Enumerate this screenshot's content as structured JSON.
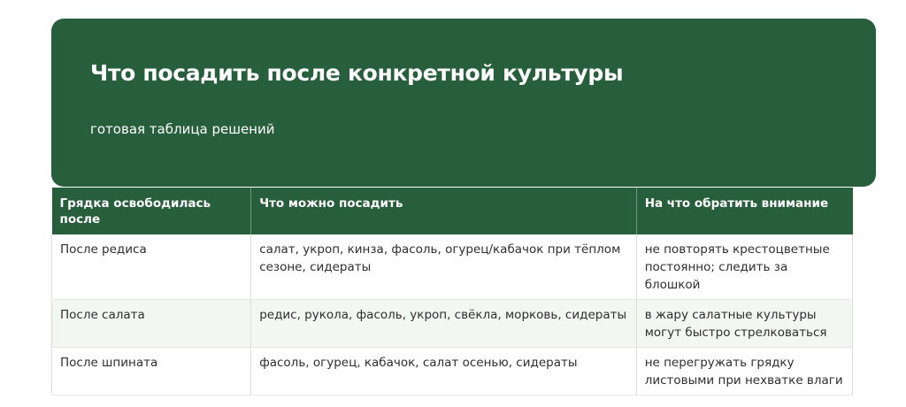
{
  "header": {
    "title": "Что посадить после конкретной культуры",
    "subtitle": "готовая таблица решений"
  },
  "table": {
    "columns": [
      "Грядка освободилась после",
      "Что можно посадить",
      "На что обратить внимание"
    ],
    "rows": [
      [
        "После редиса",
        "салат, укроп, кинза, фасоль, огурец/кабачок при тёплом сезоне, сидераты",
        "не повторять крестоцветные постоянно; следить за блошкой"
      ],
      [
        "После салата",
        "редис, рукола, фасоль, укроп, свёкла, морковь, сидераты",
        "в жару салатные культуры могут быстро стрелковаться"
      ],
      [
        "После шпината",
        "фасоль, огурец, кабачок, салат осенью, сидераты",
        "не перегружать грядку листовыми при нехватке влаги"
      ]
    ]
  },
  "colors": {
    "brand_green": "#275e3b",
    "row_alt": "#f3f7f1"
  }
}
